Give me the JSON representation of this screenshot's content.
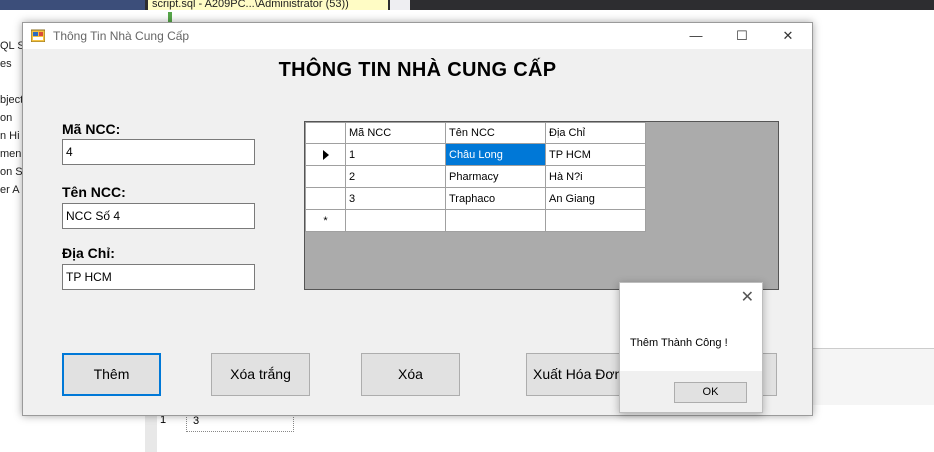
{
  "ide": {
    "tab_title": "script.sql - A209PC...\\Administrator (53))",
    "left_panel_lines": [
      "QL S",
      "es",
      "bject",
      "on",
      "n Hi",
      "men",
      "on S",
      "er A"
    ],
    "result_row_number": "1",
    "result_cell_value": "3"
  },
  "window": {
    "title": "Thông Tin Nhà Cung Cấp",
    "minimize": "—",
    "maximize": "☐",
    "close": "✕"
  },
  "form": {
    "heading": "THÔNG TIN NHÀ CUNG CẤP",
    "ma_ncc_label": "Mã NCC:",
    "ma_ncc_value": "4",
    "ten_ncc_label": "Tên NCC:",
    "ten_ncc_value": "NCC Số 4",
    "dia_chi_label": "Địa Chỉ:",
    "dia_chi_value": "TP HCM"
  },
  "grid": {
    "columns": [
      "Mã NCC",
      "Tên NCC",
      "Địa Chỉ"
    ],
    "rows": [
      [
        "1",
        "Châu Long",
        "TP HCM"
      ],
      [
        "2",
        "Pharmacy",
        "Hà N?i"
      ],
      [
        "3",
        "Traphaco",
        "An Giang"
      ]
    ],
    "new_row_marker": "*"
  },
  "buttons": {
    "them": "Thêm",
    "xoa_trang": "Xóa trắng",
    "xoa": "Xóa",
    "xuat_hoa_don": "Xuất Hóa Đơn"
  },
  "message_box": {
    "text": "Thêm Thành Công !",
    "ok": "OK",
    "close": "✕"
  },
  "colors": {
    "selection": "#0078d7",
    "form_bg": "#f0f0f0"
  }
}
